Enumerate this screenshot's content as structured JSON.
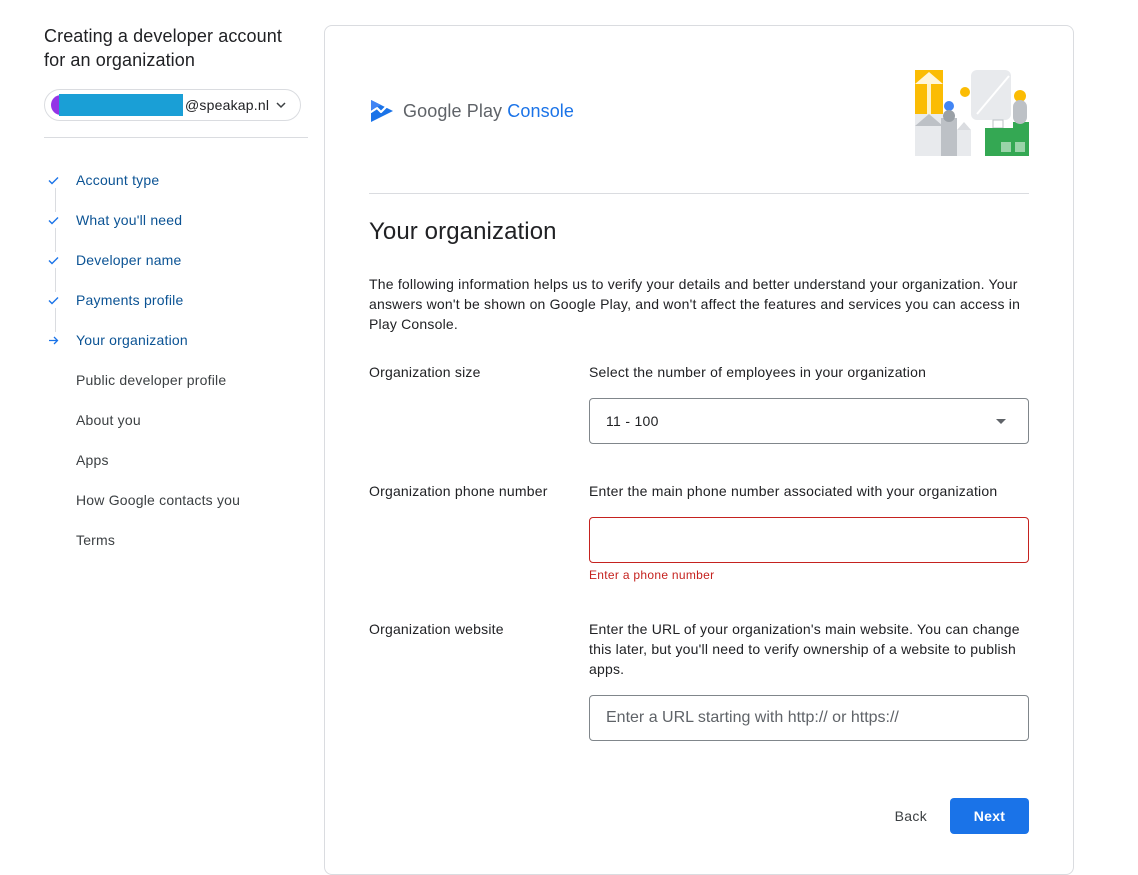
{
  "sidebar": {
    "title": "Creating a developer account for an organization",
    "account": {
      "domain": "@speakap.nl",
      "avatar_color": "#9334e6",
      "redaction_color": "#1a9fd6"
    },
    "steps": [
      {
        "label": "Account type",
        "state": "done"
      },
      {
        "label": "What you'll need",
        "state": "done"
      },
      {
        "label": "Developer name",
        "state": "done"
      },
      {
        "label": "Payments profile",
        "state": "done"
      },
      {
        "label": "Your organization",
        "state": "current"
      },
      {
        "label": "Public developer profile",
        "state": "upcoming"
      },
      {
        "label": "About you",
        "state": "upcoming"
      },
      {
        "label": "Apps",
        "state": "upcoming"
      },
      {
        "label": "How Google contacts you",
        "state": "upcoming"
      },
      {
        "label": "Terms",
        "state": "upcoming"
      }
    ]
  },
  "brand": {
    "name": "Google Play",
    "product": "Console",
    "accent_color": "#1a73e8"
  },
  "main": {
    "title": "Your organization",
    "intro": "The following information helps us to verify your details and better understand your organization. Your answers won't be shown on Google Play, and won't affect the features and services you can access in Play Console.",
    "fields": {
      "size": {
        "label": "Organization size",
        "help": "Select the number of employees in your organization",
        "value": "11 - 100"
      },
      "phone": {
        "label": "Organization phone number",
        "help": "Enter the main phone number associated with your organization",
        "value": "",
        "error": "Enter a phone number"
      },
      "website": {
        "label": "Organization website",
        "help": "Enter the URL of your organization's main website. You can change this later, but you'll need to verify ownership of a website to publish apps.",
        "value": "",
        "placeholder": "Enter a URL starting with http:// or https://"
      }
    },
    "actions": {
      "back": "Back",
      "next": "Next"
    }
  },
  "colors": {
    "primary": "#1a73e8",
    "error": "#c5221f",
    "step_link": "#0b5394"
  }
}
